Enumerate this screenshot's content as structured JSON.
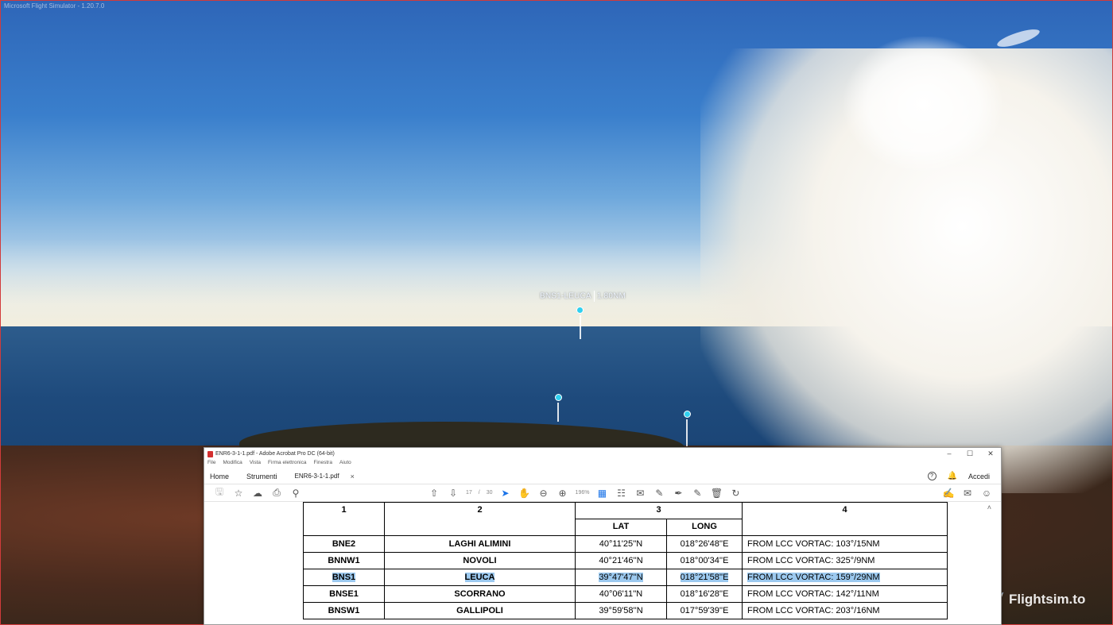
{
  "game": {
    "window_title": "Microsoft Flight Simulator - 1.20.7.0",
    "waypoint_label": "BNS1-LEUCA",
    "waypoint_distance": "1.80NM",
    "watermark": "Flightsim.to"
  },
  "acrobat": {
    "title": "ENR6-3-1-1.pdf - Adobe Acrobat Pro DC (64-bit)",
    "window_buttons": [
      "–",
      "☐",
      "✕"
    ],
    "menu": [
      "File",
      "Modifica",
      "Vista",
      "Firma elettronica",
      "Finestra",
      "Aiuto"
    ],
    "tabs": [
      "Home",
      "Strumenti"
    ],
    "doc_tab": "ENR6-3-1-1.pdf",
    "doc_tab_close": "×",
    "help": "?",
    "signin": "Accedi",
    "page_current": "17",
    "page_sep": "/",
    "page_total": "30",
    "zoom": "196%",
    "scroll_up": "˄",
    "table": {
      "headers": {
        "col1": "1",
        "col2": "2",
        "col3": "3",
        "col4": "4",
        "lat": "LAT",
        "long": "LONG"
      },
      "rows": [
        {
          "id": "BNE2",
          "name": "LAGHI ALIMINI",
          "lat": "40°11'25''N",
          "long": "018°26'48''E",
          "ref": "FROM LCC VORTAC: 103°/15NM"
        },
        {
          "id": "BNNW1",
          "name": "NOVOLI",
          "lat": "40°21'46''N",
          "long": "018°00'34''E",
          "ref": "FROM LCC VORTAC: 325°/9NM"
        },
        {
          "id": "BNS1",
          "name": "LEUCA",
          "lat": "39°47'47''N",
          "long": "018°21'58''E",
          "ref": "FROM LCC VORTAC: 159°/29NM"
        },
        {
          "id": "BNSE1",
          "name": "SCORRANO",
          "lat": "40°06'11''N",
          "long": "018°16'28''E",
          "ref": "FROM LCC VORTAC: 142°/11NM"
        },
        {
          "id": "BNSW1",
          "name": "GALLIPOLI",
          "lat": "39°59'58''N",
          "long": "017°59'39''E",
          "ref": "FROM LCC VORTAC: 203°/16NM"
        }
      ]
    }
  }
}
